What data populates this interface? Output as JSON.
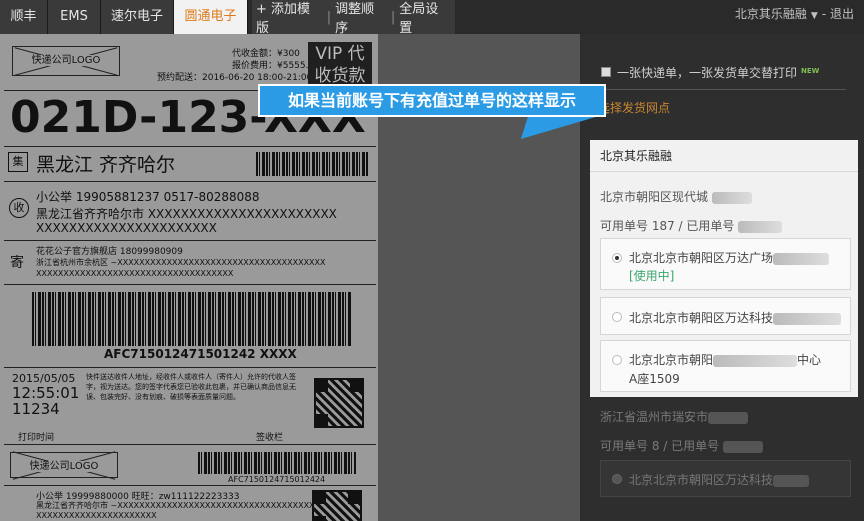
{
  "tabs": [
    {
      "label": "顺丰"
    },
    {
      "label": "EMS"
    },
    {
      "label": "速尔电子"
    },
    {
      "label": "圆通电子"
    }
  ],
  "toolbar": {
    "add": "+ 添加模版",
    "reorder": "调整顺序",
    "global": "全局设置",
    "sep": "|"
  },
  "user": {
    "name": "北京其乐融融",
    "logout": "退出",
    "sep": "-"
  },
  "tooltip": {
    "text": "如果当前账号下有充值过单号的这样显示"
  },
  "label": {
    "logo": "快递公司LOGO",
    "cod": "代收金额：¥300",
    "insured": "报价费用：¥5555.55",
    "appoint": "预约配送：2016-06-20 18:00-21:00",
    "vip": "VIP 代",
    "vip2": "收货款",
    "code": "021D-123-XXX",
    "ji": "集",
    "dest": "黑龙江 齐齐哈尔",
    "shou": "收",
    "recv_name": "小公举    19905881237    0517-80288088",
    "recv_addr1": "黑龙江省齐齐哈尔市 XXXXXXXXXXXXXXXXXXXXXXX",
    "recv_addr2": "XXXXXXXXXXXXXXXXXXXXXX",
    "ji2": "寄",
    "send_name": "花花公子官方旗舰店    18099980909",
    "send_addr1": "浙江省杭州市余杭区 ~XXXXXXXXXXXXXXXXXXXXXXXXXXXXXXXXXXXXXX",
    "send_addr2": "XXXXXXXXXXXXXXXXXXXXXXXXXXXXXXXXXXXX",
    "barcode_text": "AFC715012471501242 XXXX",
    "date": "2015/05/05",
    "time": "12:55:01",
    "num": "11234",
    "notice": "快件送达收件人地址，经收件人或收件人（寄件人）允许的代收人签字，视为送达。您的签字代表您已验收此包裹，并已确认商品信息无误、包装完好、没有划痕、破损等表面质量问题。",
    "print_time": "打印时间",
    "sign": "签收栏",
    "logo2": "快递公司LOGO",
    "barcode2": "AFC7150124715012424",
    "recv2": "小公举    19999880000    旺旺：zw111122223333",
    "recv2a": "黑龙江省齐齐哈尔市 ~XXXXXXXXXXXXXXXXXXXXXXXXXXXXXXXXXXXX",
    "recv2b": "XXXXXXXXXXXXXXXXXXXXXX"
  },
  "panel": {
    "one_print": "一张快递单，一张发货单交替打印",
    "new": "NEW",
    "select_net": "选择发货网点",
    "card_title": "北京其乐融融",
    "addr1": "北京市朝阳区现代城",
    "quota1": "可用单号 187 / 已用单号",
    "opt1": "北京北京市朝阳区万达广场",
    "inuse": "[使用中]",
    "opt2": "北京北京市朝阳区万达科技",
    "opt3a": "北京北京市朝阳",
    "opt3b": "中心",
    "opt3c": "A座1509",
    "addr2": "浙江省温州市瑞安市",
    "quota2": "可用单号 8 / 已用单号",
    "opt4": "北京北京市朝阳区万达科技"
  }
}
